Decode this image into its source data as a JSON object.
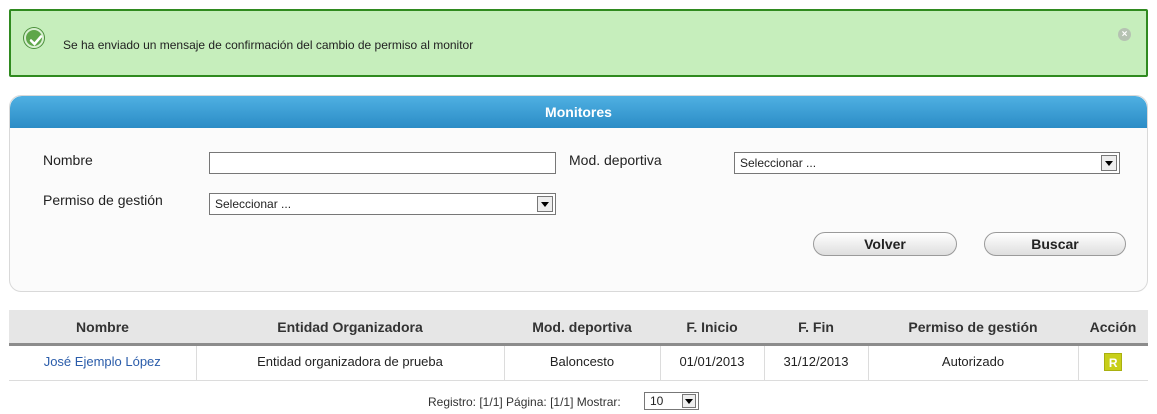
{
  "alert": {
    "message": "Se ha enviado un mensaje de confirmación del cambio de permiso al monitor",
    "icon": "check-circle-icon",
    "close_icon": "close-icon"
  },
  "panel": {
    "title": "Monitores",
    "nombre_label": "Nombre",
    "nombre_value": "",
    "mod_label": "Mod. deportiva",
    "mod_value": "Seleccionar ...",
    "permiso_label": "Permiso de gestión",
    "permiso_value": "Seleccionar ...",
    "volver_label": "Volver",
    "buscar_label": "Buscar"
  },
  "table": {
    "headers": [
      "Nombre",
      "Entidad Organizadora",
      "Mod. deportiva",
      "F. Inicio",
      "F. Fin",
      "Permiso de gestión",
      "Acción"
    ],
    "rows": [
      {
        "nombre": "José Ejemplo López",
        "entidad": "Entidad organizadora de prueba",
        "mod": "Baloncesto",
        "inicio": "01/01/2013",
        "fin": "31/12/2013",
        "permiso": "Autorizado",
        "accion": "R"
      }
    ]
  },
  "pager": {
    "text": "Registro: [1/1] Página: [1/1] Mostrar:",
    "show_value": "10"
  },
  "colors": {
    "alert_bg": "#c6eebc",
    "alert_border": "#2f8a1f",
    "header_blue": "#3a9dd6",
    "link": "#2a5caa",
    "action": "#c8cf19"
  }
}
